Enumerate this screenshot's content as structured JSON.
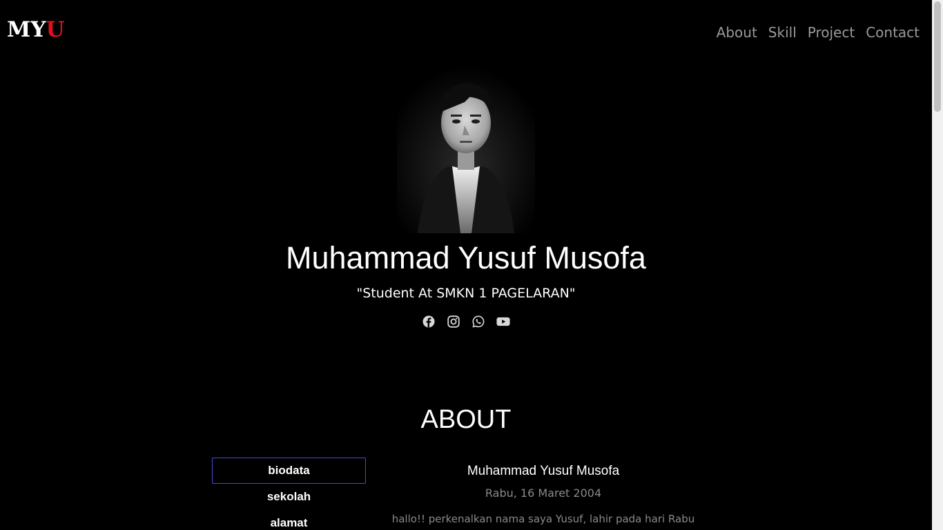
{
  "brand": {
    "primary": "MY",
    "accent": "U",
    "accent_color": "#e0111c"
  },
  "nav": {
    "items": [
      {
        "label": "About"
      },
      {
        "label": "Skill"
      },
      {
        "label": "Project"
      },
      {
        "label": "Contact"
      }
    ]
  },
  "hero": {
    "name": "Muhammad Yusuf Musofa",
    "tagline": "\"Student At SMKN 1 PAGELARAN\"",
    "socials": [
      {
        "icon": "facebook-icon"
      },
      {
        "icon": "instagram-icon"
      },
      {
        "icon": "whatsapp-icon"
      },
      {
        "icon": "youtube-icon"
      }
    ]
  },
  "about": {
    "title": "ABOUT",
    "tabs": [
      {
        "label": "biodata",
        "active": true
      },
      {
        "label": "sekolah",
        "active": false
      },
      {
        "label": "alamat",
        "active": false
      }
    ],
    "bio": {
      "name": "Muhammad Yusuf Musofa",
      "date": "Rabu, 16 Maret 2004",
      "text": "hallo!! perkenalkan nama saya Yusuf, lahir pada hari Rabu"
    }
  },
  "colors": {
    "background": "#000000",
    "tab_border": "#4b4bd8",
    "muted_text": "#8a8a8a"
  }
}
